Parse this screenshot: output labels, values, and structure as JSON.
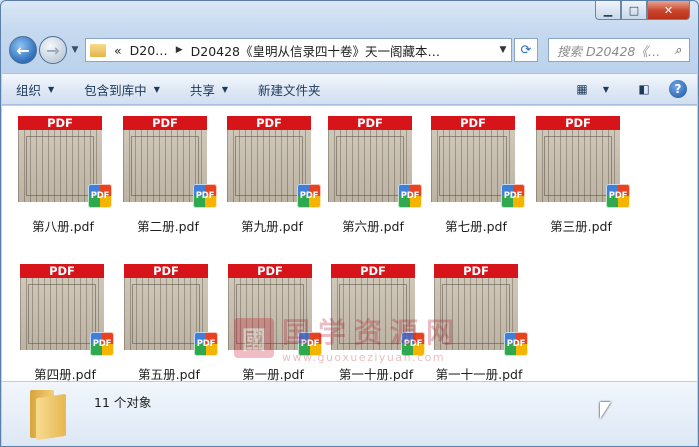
{
  "address": {
    "crumbs": [
      "D20…",
      "D20428《皇明从信录四十卷》天一阁藏本…"
    ],
    "overflow": "«"
  },
  "search": {
    "placeholder": "搜索 D20428《…"
  },
  "toolbar": {
    "organize": "组织",
    "include_library": "包含到库中",
    "share": "共享",
    "new_folder": "新建文件夹"
  },
  "files": [
    {
      "name": "第八册.pdf",
      "band": "PDF",
      "badge": "PDF"
    },
    {
      "name": "第二册.pdf",
      "band": "PDF",
      "badge": "PDF"
    },
    {
      "name": "第九册.pdf",
      "band": "PDF",
      "badge": "PDF"
    },
    {
      "name": "第六册.pdf",
      "band": "PDF",
      "badge": "PDF"
    },
    {
      "name": "第七册.pdf",
      "band": "PDF",
      "badge": "PDF"
    },
    {
      "name": "第三册.pdf",
      "band": "PDF",
      "badge": "PDF"
    },
    {
      "name": "第四册.pdf",
      "band": "PDF",
      "badge": "PDF"
    },
    {
      "name": "第五册.pdf",
      "band": "PDF",
      "badge": "PDF"
    },
    {
      "name": "第一册.pdf",
      "band": "PDF",
      "badge": "PDF"
    },
    {
      "name": "第一十册.pdf",
      "band": "PDF",
      "badge": "PDF"
    },
    {
      "name": "第一十一册.pdf",
      "band": "PDF",
      "badge": "PDF"
    }
  ],
  "status": {
    "item_count": "11 个对象"
  },
  "watermark": {
    "seal": "國",
    "title": "国学资源网",
    "url": "www.guoxueziyuan.com"
  },
  "colors": {
    "pdf_band": "#d8141b",
    "window_frame": "#5b7fa8",
    "toolbar_text": "#1e395b"
  }
}
